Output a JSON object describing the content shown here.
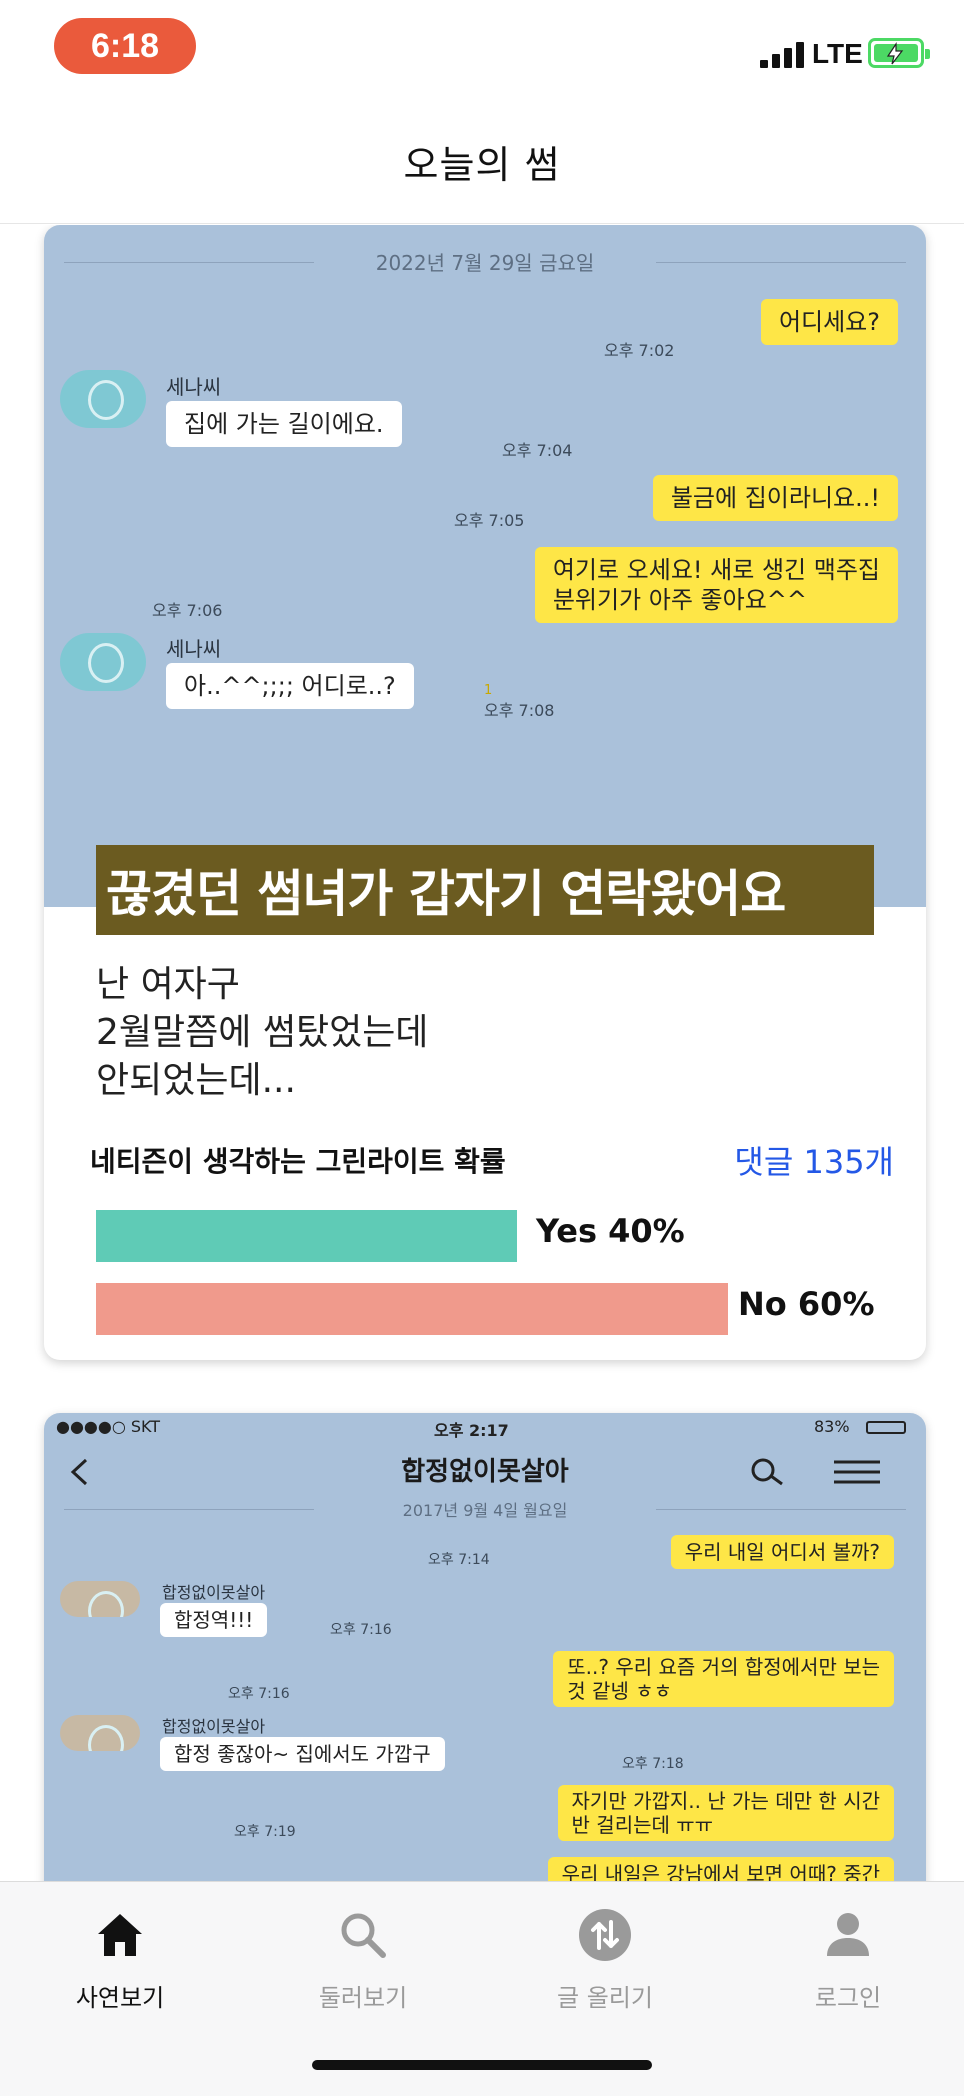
{
  "status_bar": {
    "time": "6:18",
    "network": "LTE"
  },
  "header": {
    "title": "오늘의 썸"
  },
  "card1": {
    "chat": {
      "date": "2022년 7월 29일 금요일",
      "messages": [
        {
          "text": "어디세요?",
          "time": "오후 7:02"
        },
        {
          "sender": "세나씨",
          "text": "집에 가는 길이에요.",
          "time": "오후 7:04"
        },
        {
          "text": "불금에 집이라니요..!",
          "time": "오후 7:05"
        },
        {
          "text": "여기로 오세요! 새로 생긴 맥주집\n분위기가 아주 좋아요^^",
          "time": "오후 7:06"
        },
        {
          "sender": "세나씨",
          "text": "아..^^;;;; 어디로..?",
          "time": "오후 7:08",
          "unread": "1"
        }
      ]
    },
    "headline": "끊겼던 썸녀가 갑자기 연락왔어요",
    "body_lines": [
      "난 여자구",
      "2월말쯤에 썸탔었는데",
      "안되었는데..."
    ],
    "probability_label": "네티즌이 생각하는 그린라이트 확률",
    "comments": "댓글 135개",
    "yes": {
      "label": "Yes 40%",
      "percent": 40,
      "color": "#5fcbb6"
    },
    "no": {
      "label": "No 60%",
      "percent": 60,
      "color": "#f09a8c"
    }
  },
  "card2": {
    "status": {
      "carrier": "●●●●○ SKT",
      "time": "오후 2:17",
      "battery": "83%"
    },
    "title": "합정없이못살아",
    "chat": {
      "date": "2017년 9월 4일 월요일",
      "messages": [
        {
          "text": "우리 내일 어디서 볼까?",
          "time": "오후 7:14"
        },
        {
          "sender": "합정없이못살아",
          "text": "합정역!!!",
          "time": "오후 7:16"
        },
        {
          "text": "또..? 우리 요즘 거의 합정에서만 보는\n것 같넹 ㅎㅎ",
          "time": "오후 7:16"
        },
        {
          "sender": "합정없이못살아",
          "text": "합정 좋잖아~ 집에서도 가깝구",
          "time": "오후 7:18"
        },
        {
          "text": "자기만 가깝지.. 난 가는 데만 한 시간\n반 걸리는데 ㅠㅠ",
          "time": "오후 7:19"
        },
        {
          "text": "우리 내일은 강남에서 보면 어때? 중간"
        }
      ]
    }
  },
  "tabs": [
    {
      "label": "사연보기",
      "icon": "home-icon",
      "active": true
    },
    {
      "label": "둘러보기",
      "icon": "search-icon"
    },
    {
      "label": "글 올리기",
      "icon": "upload-icon"
    },
    {
      "label": "로그인",
      "icon": "person-icon"
    }
  ]
}
